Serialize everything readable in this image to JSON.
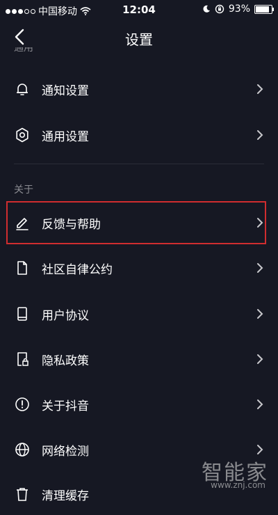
{
  "status_bar": {
    "carrier": "中国移动",
    "time": "12:04",
    "battery": "93%",
    "battery_level": 0.93,
    "icons": [
      "signal-dots",
      "wifi-icon",
      "moon-icon",
      "rotation-lock-icon",
      "battery-icon"
    ]
  },
  "nav": {
    "title": "设置",
    "back_icon": "back-chevron-icon"
  },
  "sections": {
    "general_clipped": "通用",
    "about": "关于"
  },
  "items": [
    {
      "label": "通知设置",
      "icon": "bell-icon"
    },
    {
      "label": "通用设置",
      "icon": "gear-icon"
    },
    {
      "label": "反馈与帮助",
      "icon": "pencil-icon"
    },
    {
      "label": "社区自律公约",
      "icon": "document-icon"
    },
    {
      "label": "用户协议",
      "icon": "book-icon"
    },
    {
      "label": "隐私政策",
      "icon": "lock-document-icon"
    },
    {
      "label": "关于抖音",
      "icon": "info-exclamation-icon"
    },
    {
      "label": "网络检测",
      "icon": "globe-icon"
    },
    {
      "label": "清理缓存",
      "icon": "trash-icon"
    }
  ],
  "watermark": {
    "text": "智能家",
    "url": "www.znj.com"
  },
  "colors": {
    "background": "#161823",
    "highlight": "#d02d2f",
    "secondary_text": "#8a8b91"
  }
}
